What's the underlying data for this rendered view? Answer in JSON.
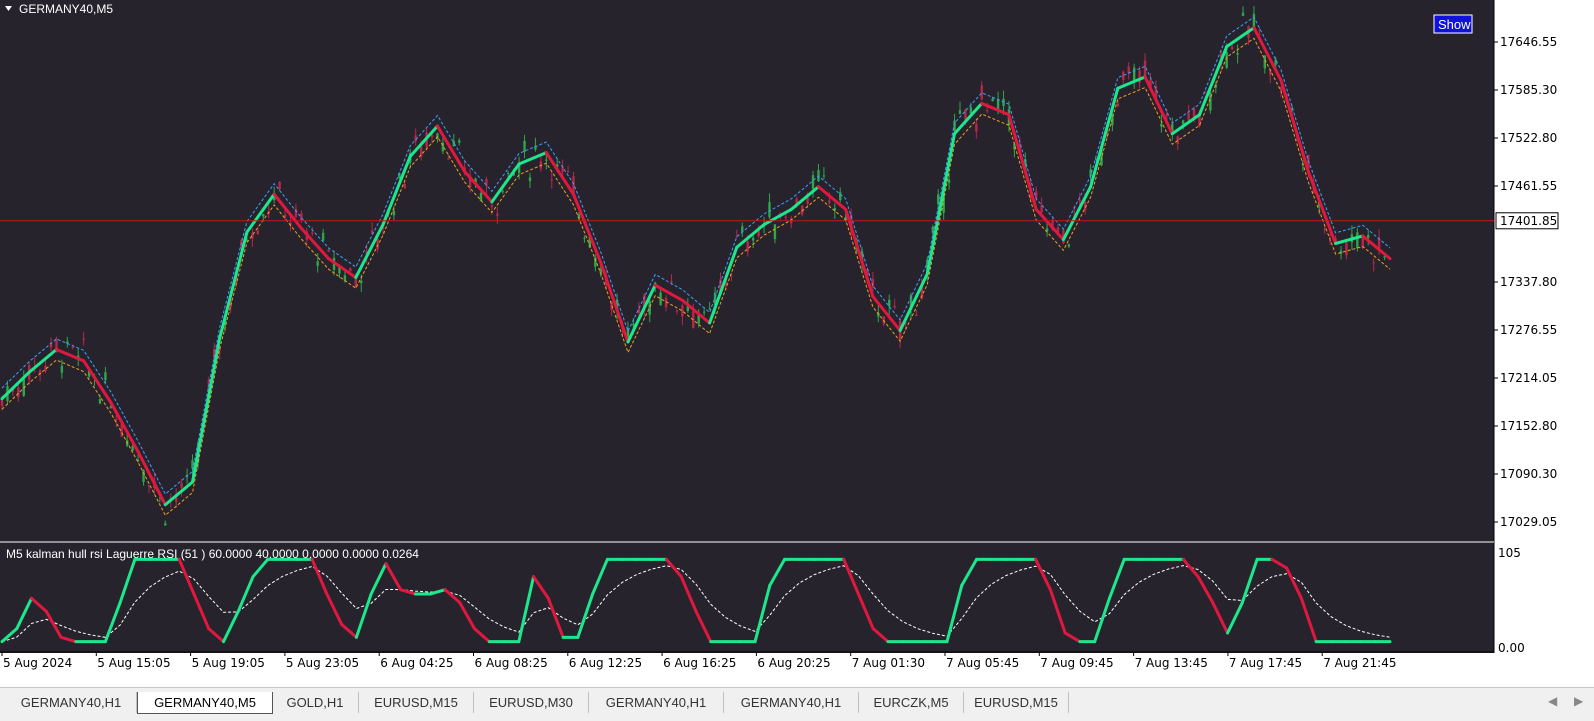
{
  "chart_title": "GERMANY40,M5",
  "show_button": "Show",
  "price_label": "17401.85",
  "indicator_label": "M5 kalman hull rsi  Laguerre RSI (51  ) 60.0000 40.0000 0.0000 0.0000 0.0264",
  "colors": {
    "background": "#27232d",
    "bull": "#1de78c",
    "bear": "#e0183f",
    "band_upper": "#3aa0ff",
    "band_lower": "#f0a020",
    "hline": "#c01818"
  },
  "chart_data": [
    {
      "type": "line",
      "title": "GERMANY40,M5",
      "ylim": [
        16990,
        17690
      ],
      "yticks": [
        "17646.55",
        "17585.30",
        "17522.80",
        "17461.55",
        "17401.85",
        "17337.80",
        "17276.55",
        "17214.05",
        "17152.80",
        "17090.30",
        "17029.05"
      ],
      "xticks": [
        "5 Aug 2024",
        "5 Aug 15:05",
        "5 Aug 19:05",
        "5 Aug 23:05",
        "6 Aug 04:25",
        "6 Aug 08:25",
        "6 Aug 12:25",
        "6 Aug 16:25",
        "6 Aug 20:25",
        "7 Aug 01:30",
        "7 Aug 05:45",
        "7 Aug 09:45",
        "7 Aug 13:45",
        "7 Aug 17:45",
        "7 Aug 21:45"
      ],
      "hline": 17405,
      "series": [
        {
          "values": [
            17170,
            17205,
            17235,
            17220,
            17165,
            17100,
            17030,
            17060,
            17250,
            17390,
            17440,
            17395,
            17355,
            17330,
            17400,
            17490,
            17530,
            17470,
            17430,
            17480,
            17495,
            17440,
            17350,
            17245,
            17320,
            17300,
            17270,
            17370,
            17400,
            17420,
            17450,
            17420,
            17305,
            17260,
            17335,
            17520,
            17560,
            17545,
            17420,
            17380,
            17450,
            17580,
            17595,
            17520,
            17545,
            17635,
            17660,
            17590,
            17470,
            17375,
            17385,
            17355
          ]
        }
      ]
    },
    {
      "type": "line",
      "title": "M5 kalman hull rsi  Laguerre RSI (51  ) 60.0000 40.0000 0.0000 0.0000 0.0264",
      "ylim": [
        0,
        105
      ],
      "yticks": [
        "105",
        "0.00"
      ],
      "series": [
        {
          "values": [
            5,
            20,
            55,
            40,
            10,
            5,
            5,
            5,
            50,
            100,
            100,
            100,
            100,
            60,
            20,
            5,
            40,
            80,
            100,
            100,
            100,
            100,
            60,
            25,
            10,
            60,
            95,
            65,
            60,
            60,
            65,
            50,
            20,
            5,
            5,
            5,
            80,
            55,
            10,
            10,
            60,
            100,
            100,
            100,
            100,
            100,
            80,
            40,
            5,
            5,
            5,
            5,
            70,
            100,
            100,
            100,
            100,
            100,
            60,
            20,
            5,
            5,
            5,
            5,
            5,
            70,
            100,
            100,
            100,
            100,
            100,
            65,
            15,
            5,
            5,
            55,
            100,
            100,
            100,
            100,
            100,
            80,
            50,
            15,
            50,
            100,
            100,
            90,
            55,
            5,
            5,
            5,
            5,
            5,
            5
          ]
        }
      ]
    }
  ],
  "tabs": [
    "GERMANY40,H1",
    "GERMANY40,M5",
    "GOLD,H1",
    "EURUSD,M15",
    "EURUSD,M30",
    "GERMANY40,H1",
    "GERMANY40,H1",
    "EURCZK,M5",
    "EURUSD,M15"
  ],
  "active_tab": 1
}
